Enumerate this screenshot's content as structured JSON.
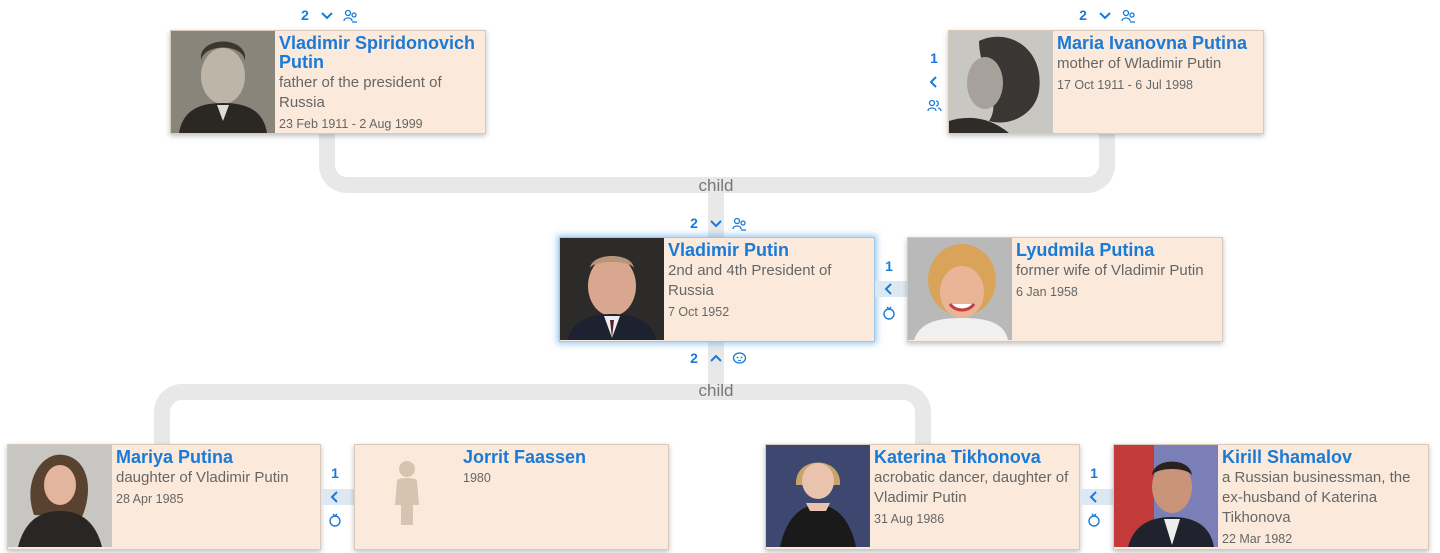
{
  "relation_labels": {
    "parents_child": "child",
    "children_child": "child"
  },
  "father": {
    "name": "Vladimir Spiridonovich Putin",
    "description": "father of the president of Russia",
    "dates": "23 Feb 1911 - 2 Aug 1999",
    "parents_count": "2"
  },
  "mother": {
    "name": "Maria Ivanovna Putina",
    "description": "mother of Wladimir Putin",
    "dates": "17 Oct 1911 - 6 Jul 1998",
    "parents_count": "2",
    "spouses_count": "1"
  },
  "focus": {
    "name": "Vladimir Putin",
    "description": "2nd and 4th President of Russia",
    "dates": "7 Oct 1952",
    "parents_count": "2",
    "children_count": "2",
    "spouses_count": "1"
  },
  "focus_spouse": {
    "name": "Lyudmila Putina",
    "description": "former wife of Vladimir Putin",
    "dates": "6 Jan 1958"
  },
  "child1": {
    "name": "Mariya Putina",
    "description": "daughter of Vladimir Putin",
    "dates": "28 Apr 1985",
    "spouses_count": "1"
  },
  "child1_spouse": {
    "name": "Jorrit Faassen",
    "description": "",
    "dates": "1980"
  },
  "child2": {
    "name": "Katerina Tikhonova",
    "description": "acrobatic dancer, daughter of Vladimir Putin",
    "dates": "31 Aug 1986",
    "spouses_count": "1"
  },
  "child2_spouse": {
    "name": "Kirill Shamalov",
    "description": "a Russian businessman, the ex-husband of Katerina Tikhonova",
    "dates": "22 Mar 1982"
  },
  "colors": {
    "link": "#1a7ad8",
    "card_bg": "#fbeadb",
    "connector": "#e8e8e8"
  },
  "icons": [
    "chevron-down-icon",
    "chevron-up-icon",
    "chevron-left-icon",
    "parents-icon",
    "people-icon",
    "ring-icon",
    "child-icon",
    "person-silhouette-icon"
  ]
}
